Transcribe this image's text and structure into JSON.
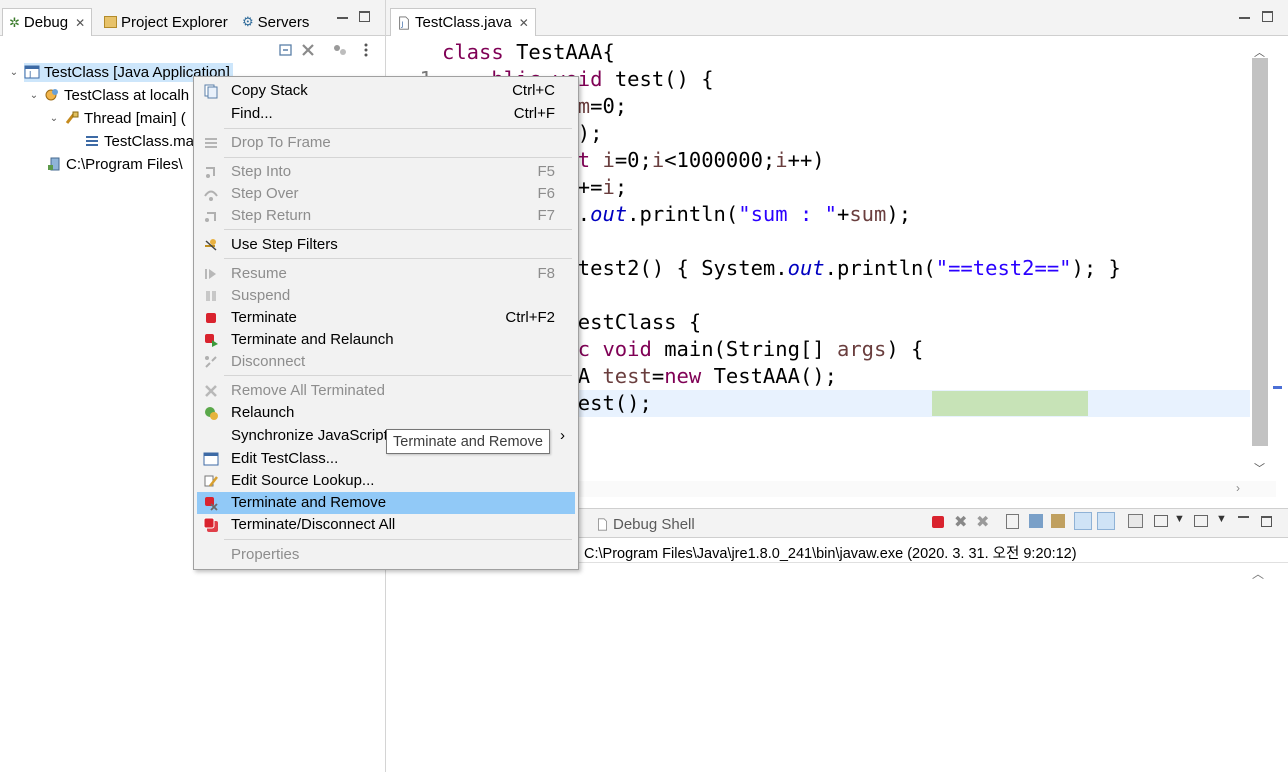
{
  "left_view": {
    "tabs": [
      {
        "label": "Debug",
        "icon": "debug-bug-icon",
        "active": true
      },
      {
        "label": "Project Explorer",
        "icon": "project-explorer-icon"
      },
      {
        "label": "Servers",
        "icon": "servers-icon"
      }
    ],
    "tree": [
      {
        "label": "TestClass [Java Application]",
        "icon": "java-app-icon",
        "level": 0
      },
      {
        "label": "TestClass at localh",
        "icon": "vm-icon",
        "level": 1
      },
      {
        "label": "Thread [main] (",
        "icon": "thread-icon",
        "level": 2
      },
      {
        "label": "TestClass.ma",
        "icon": "stack-frame-icon",
        "level": 3
      },
      {
        "label": "C:\\Program Files\\",
        "icon": "process-icon",
        "level": 1
      }
    ]
  },
  "editor": {
    "tab_label": "TestClass.java",
    "line_number": "1",
    "lines": [
      {
        "parts": [
          {
            "t": "class ",
            "c": "kw"
          },
          {
            "t": "TestAAA{",
            "c": ""
          }
        ]
      },
      {
        "parts": [
          {
            "t": "    ",
            "c": ""
          },
          {
            "t": "blic ",
            "c": "kw"
          },
          {
            "t": "void ",
            "c": "kw"
          },
          {
            "t": "test() {",
            "c": ""
          }
        ]
      },
      {
        "parts": [
          {
            "t": "       ",
            "c": ""
          },
          {
            "t": "t ",
            "c": "kw"
          },
          {
            "t": "sum",
            "c": "loc"
          },
          {
            "t": "=0;",
            "c": ""
          }
        ]
      },
      {
        "parts": [
          {
            "t": "       ",
            "c": ""
          },
          {
            "t": "st2();",
            "c": ""
          }
        ]
      },
      {
        "parts": [
          {
            "t": "       ",
            "c": ""
          },
          {
            "t": "r",
            "c": "kw"
          },
          {
            "t": "(",
            "c": ""
          },
          {
            "t": "int ",
            "c": "kw"
          },
          {
            "t": "i",
            "c": "loc"
          },
          {
            "t": "=0;",
            "c": ""
          },
          {
            "t": "i",
            "c": "loc"
          },
          {
            "t": "<1000000;",
            "c": ""
          },
          {
            "t": "i",
            "c": "loc"
          },
          {
            "t": "++)",
            "c": ""
          }
        ]
      },
      {
        "parts": [
          {
            "t": "        ",
            "c": ""
          },
          {
            "t": "sum",
            "c": "loc"
          },
          {
            "t": "+=",
            "c": ""
          },
          {
            "t": "i",
            "c": "loc"
          },
          {
            "t": ";",
            "c": ""
          }
        ]
      },
      {
        "parts": [
          {
            "t": "       ",
            "c": ""
          },
          {
            "t": "stem.",
            "c": ""
          },
          {
            "t": "out",
            "c": "fld"
          },
          {
            "t": ".println(",
            "c": ""
          },
          {
            "t": "\"sum : \"",
            "c": "str"
          },
          {
            "t": "+",
            "c": ""
          },
          {
            "t": "sum",
            "c": "loc"
          },
          {
            "t": ");",
            "c": ""
          }
        ]
      },
      {
        "parts": []
      },
      {
        "parts": [
          {
            "t": "      ",
            "c": ""
          },
          {
            "t": "void ",
            "c": "kw"
          },
          {
            "t": "test2() { System.",
            "c": ""
          },
          {
            "t": "out",
            "c": "fld"
          },
          {
            "t": ".println(",
            "c": ""
          },
          {
            "t": "\"==test2==\"",
            "c": "str"
          },
          {
            "t": "); }",
            "c": ""
          }
        ]
      },
      {
        "parts": []
      },
      {
        "parts": [
          {
            "t": "       ",
            "c": ""
          },
          {
            "t": "ss ",
            "c": "kw"
          },
          {
            "t": "TestClass {",
            "c": ""
          }
        ]
      },
      {
        "parts": [
          {
            "t": "      ",
            "c": ""
          },
          {
            "t": "static ",
            "c": "kw"
          },
          {
            "t": "void ",
            "c": "kw"
          },
          {
            "t": "main(String[] ",
            "c": ""
          },
          {
            "t": "args",
            "c": "loc"
          },
          {
            "t": ") {",
            "c": ""
          }
        ]
      },
      {
        "parts": [
          {
            "t": "       ",
            "c": ""
          },
          {
            "t": "stAAA ",
            "c": ""
          },
          {
            "t": "test",
            "c": "loc"
          },
          {
            "t": "=",
            "c": ""
          },
          {
            "t": "new ",
            "c": "kw"
          },
          {
            "t": "TestAAA();",
            "c": ""
          }
        ]
      },
      {
        "parts": [
          {
            "t": "       ",
            "c": ""
          },
          {
            "t": "st",
            "c": "loc"
          },
          {
            "t": ".test();",
            "c": ""
          }
        ]
      }
    ]
  },
  "console": {
    "tab_label": "Debug Shell",
    "header": "C:\\Program Files\\Java\\jre1.8.0_241\\bin\\javaw.exe (2020. 3. 31. 오전 9:20:12)"
  },
  "context_menu": {
    "items": [
      {
        "label": "Copy Stack",
        "shortcut": "Ctrl+C",
        "icon": "copy-stack-icon",
        "enabled": true
      },
      {
        "label": "Find...",
        "shortcut": "Ctrl+F",
        "icon": "",
        "enabled": true
      },
      {
        "separator": true
      },
      {
        "label": "Drop To Frame",
        "shortcut": "",
        "icon": "drop-to-frame-icon",
        "enabled": false
      },
      {
        "separator": true
      },
      {
        "label": "Step Into",
        "shortcut": "F5",
        "icon": "step-into-icon",
        "enabled": false
      },
      {
        "label": "Step Over",
        "shortcut": "F6",
        "icon": "step-over-icon",
        "enabled": false
      },
      {
        "label": "Step Return",
        "shortcut": "F7",
        "icon": "step-return-icon",
        "enabled": false
      },
      {
        "separator": true
      },
      {
        "label": "Use Step Filters",
        "shortcut": "",
        "icon": "step-filters-icon",
        "enabled": true
      },
      {
        "separator": true
      },
      {
        "label": "Resume",
        "shortcut": "F8",
        "icon": "resume-icon",
        "enabled": false
      },
      {
        "label": "Suspend",
        "shortcut": "",
        "icon": "suspend-icon",
        "enabled": false
      },
      {
        "label": "Terminate",
        "shortcut": "Ctrl+F2",
        "icon": "terminate-icon",
        "enabled": true
      },
      {
        "label": "Terminate and Relaunch",
        "shortcut": "",
        "icon": "terminate-relaunch-icon",
        "enabled": true
      },
      {
        "label": "Disconnect",
        "shortcut": "",
        "icon": "disconnect-icon",
        "enabled": false
      },
      {
        "separator": true
      },
      {
        "label": "Remove All Terminated",
        "shortcut": "",
        "icon": "remove-all-terminated-icon",
        "enabled": false
      },
      {
        "label": "Relaunch",
        "shortcut": "",
        "icon": "relaunch-icon",
        "enabled": true
      },
      {
        "label": "Synchronize JavaScript",
        "shortcut": "",
        "icon": "",
        "enabled": true,
        "submenu": true
      },
      {
        "label": "Edit TestClass...",
        "shortcut": "",
        "icon": "edit-launch-config-icon",
        "enabled": true
      },
      {
        "label": "Edit Source Lookup...",
        "shortcut": "",
        "icon": "edit-source-lookup-icon",
        "enabled": true
      },
      {
        "label": "Terminate and Remove",
        "shortcut": "",
        "icon": "terminate-remove-icon",
        "enabled": true,
        "selected": true
      },
      {
        "label": "Terminate/Disconnect All",
        "shortcut": "",
        "icon": "terminate-all-icon",
        "enabled": true
      },
      {
        "separator": true
      },
      {
        "label": "Properties",
        "shortcut": "",
        "icon": "",
        "enabled": false
      }
    ],
    "tooltip": "Terminate and Remove"
  },
  "colors": {
    "keyword": "#7f0055",
    "string": "#2a00ff",
    "static_field": "#0000c0",
    "local_var": "#6a3e3e",
    "menu_selection": "#91c9f7",
    "exec_highlight": "#c7e3b7",
    "current_line": "#e8f2fe"
  }
}
